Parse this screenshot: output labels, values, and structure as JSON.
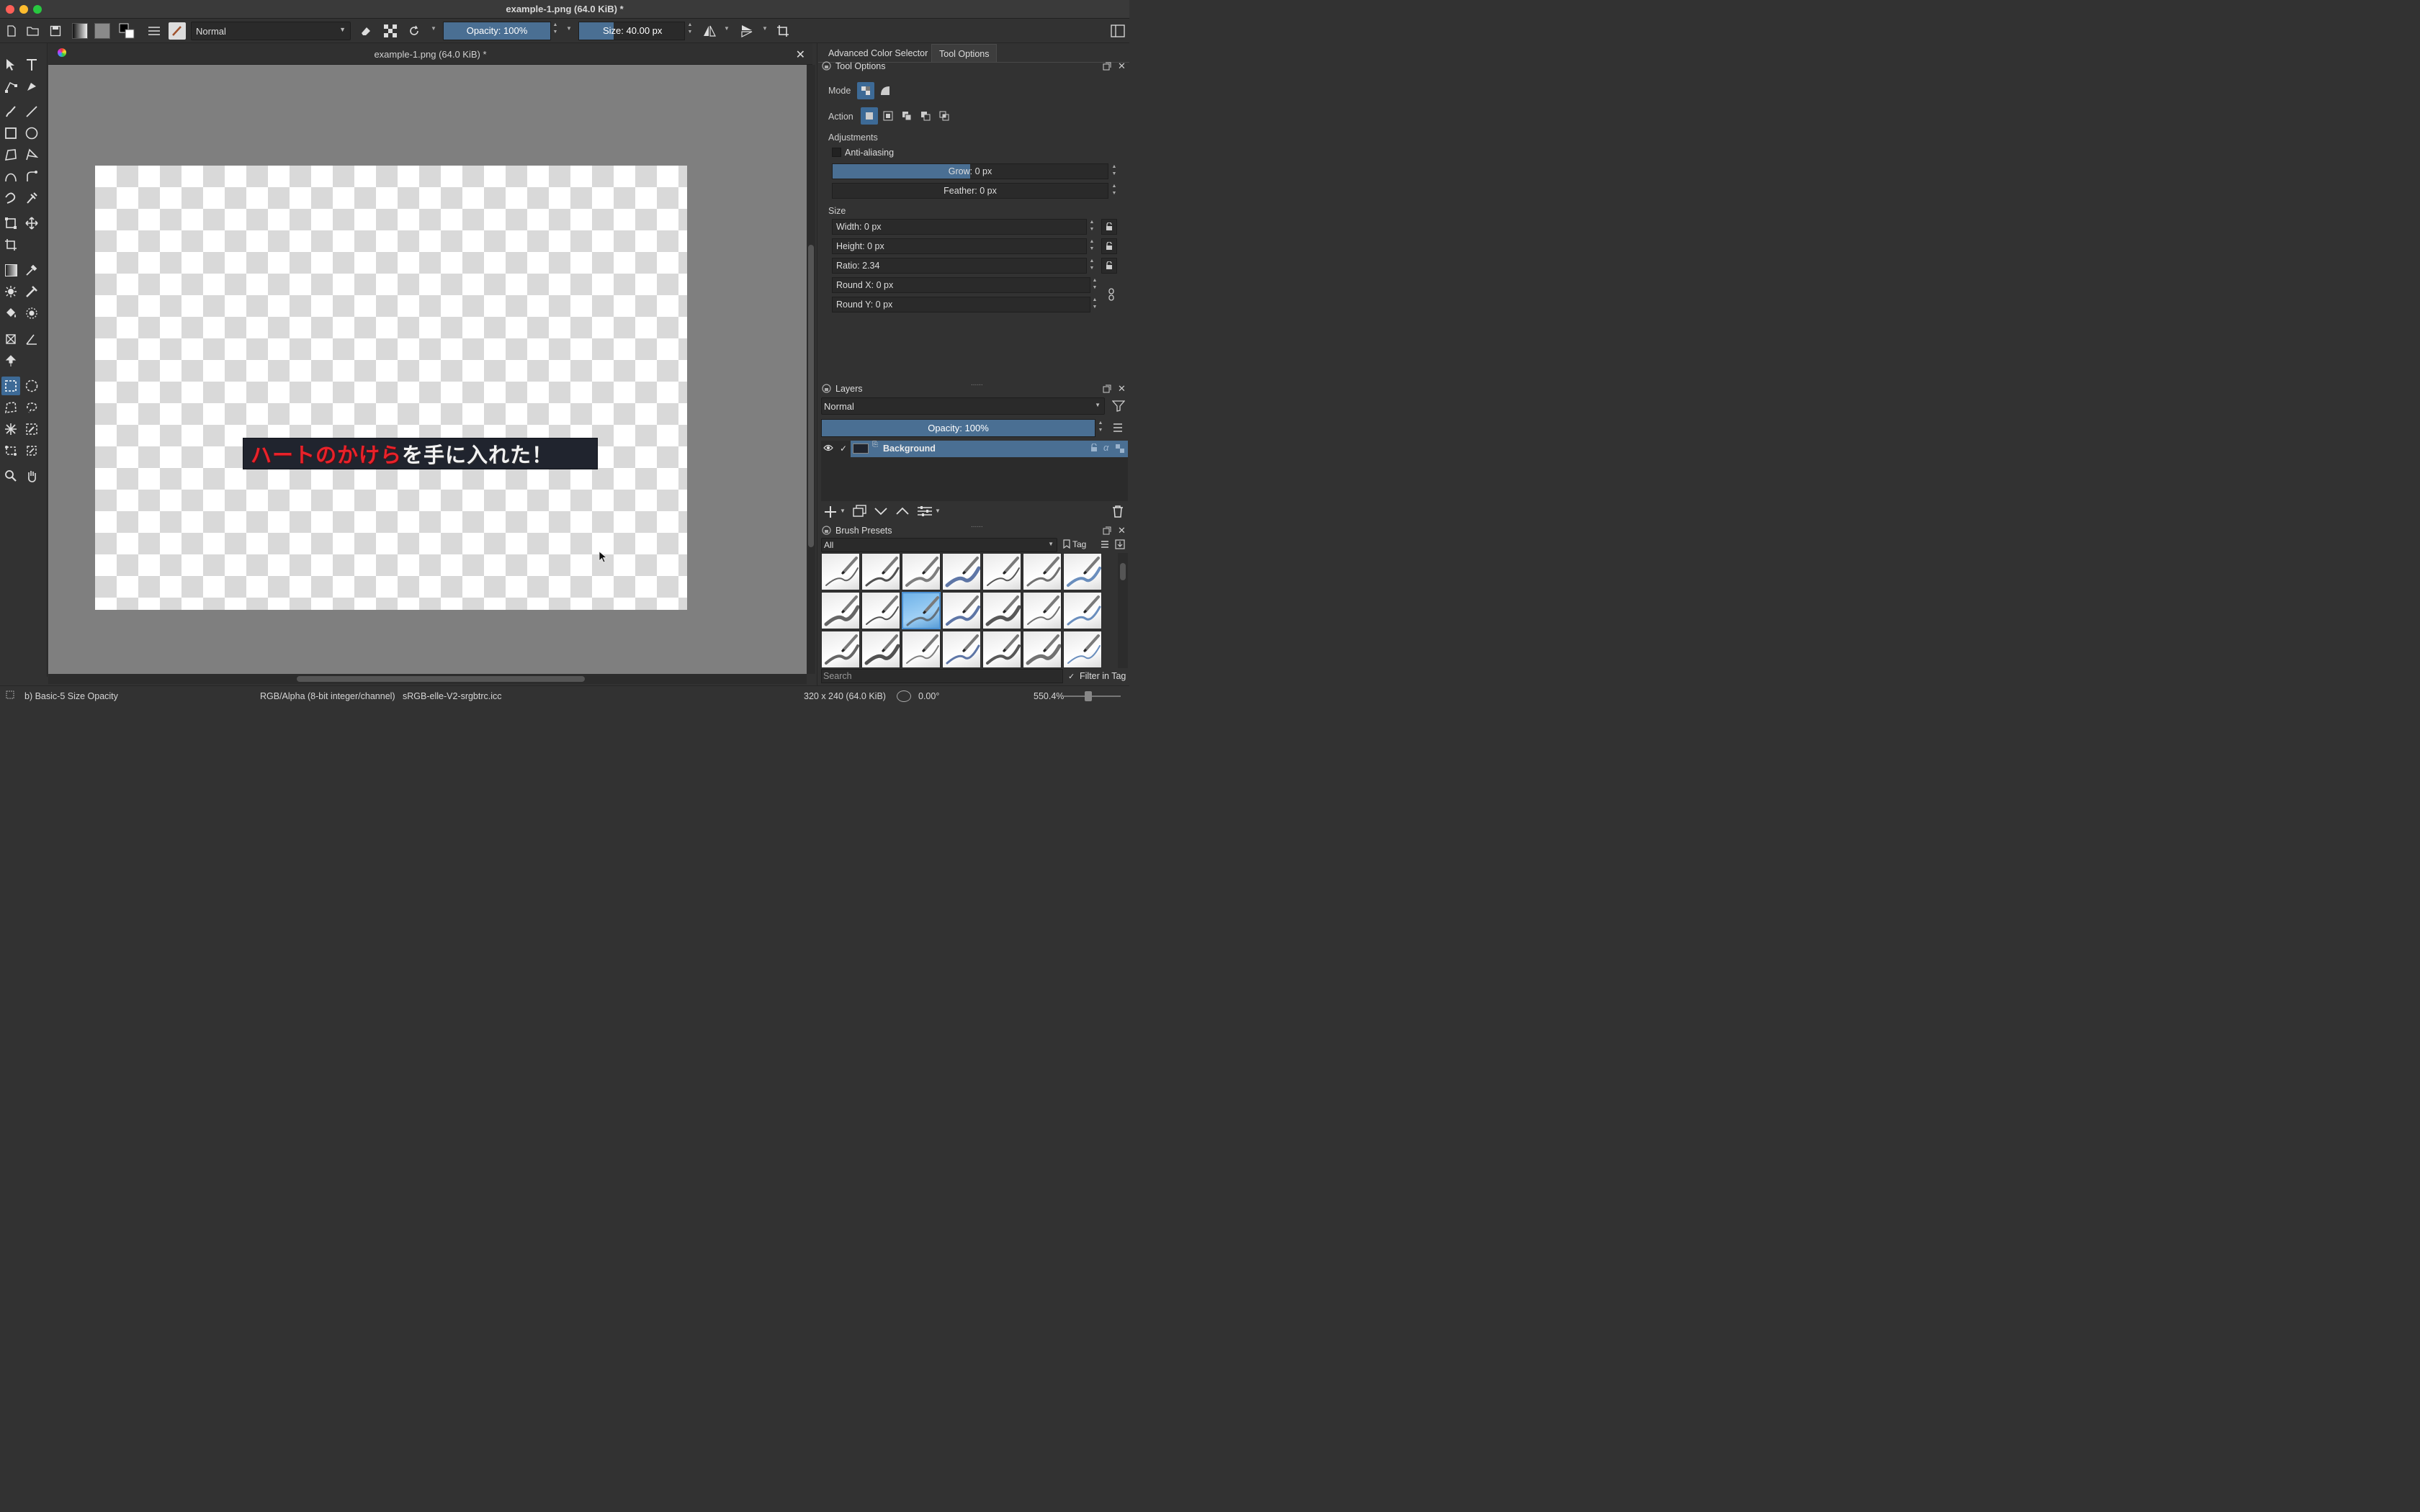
{
  "window": {
    "title": "example-1.png (64.0 KiB) *"
  },
  "toolbar": {
    "blend_mode": "Normal",
    "opacity_label": "Opacity: 100%",
    "opacity_value": 100,
    "size_label": "Size: 40.00 px",
    "size_fill_fraction": 0.33
  },
  "document": {
    "tab_title": "example-1.png (64.0 KiB) *",
    "banner_red": "ハートのかけら",
    "banner_white": "を手に入れた！"
  },
  "dock_tabs": [
    "Advanced Color Selector",
    "Tool Options"
  ],
  "tool_options": {
    "panel_title": "Tool Options",
    "mode_label": "Mode",
    "action_label": "Action",
    "adjustments_label": "Adjustments",
    "anti_aliasing_label": "Anti-aliasing",
    "grow_label": "Grow: 0 px",
    "feather_label": "Feather: 0 px",
    "size_label": "Size",
    "width": "Width: 0 px",
    "height": "Height: 0 px",
    "ratio": "Ratio: 2.34",
    "round_x": "Round X: 0 px",
    "round_y": "Round Y: 0 px"
  },
  "layers": {
    "panel_title": "Layers",
    "blend_mode": "Normal",
    "opacity_label": "Opacity:  100%",
    "items": [
      {
        "name": "Background",
        "visible": true,
        "selected": true
      }
    ]
  },
  "brush_presets": {
    "panel_title": "Brush Presets",
    "filter": "All",
    "tag_label": "Tag",
    "search_placeholder": "Search",
    "filter_in_tag": "Filter in Tag",
    "selected_index": 9,
    "count": 21
  },
  "statusbar": {
    "preset_name": "b) Basic-5 Size Opacity",
    "color_model": "RGB/Alpha (8-bit integer/channel)",
    "profile": "sRGB-elle-V2-srgbtrc.icc",
    "image_size": "320 x 240 (64.0 KiB)",
    "rotation": "0.00°",
    "zoom": "550.4%"
  },
  "colors": {
    "accent": "#4a6f93",
    "panel_bg": "#323232",
    "canvas_bg": "#7f7f7f"
  }
}
